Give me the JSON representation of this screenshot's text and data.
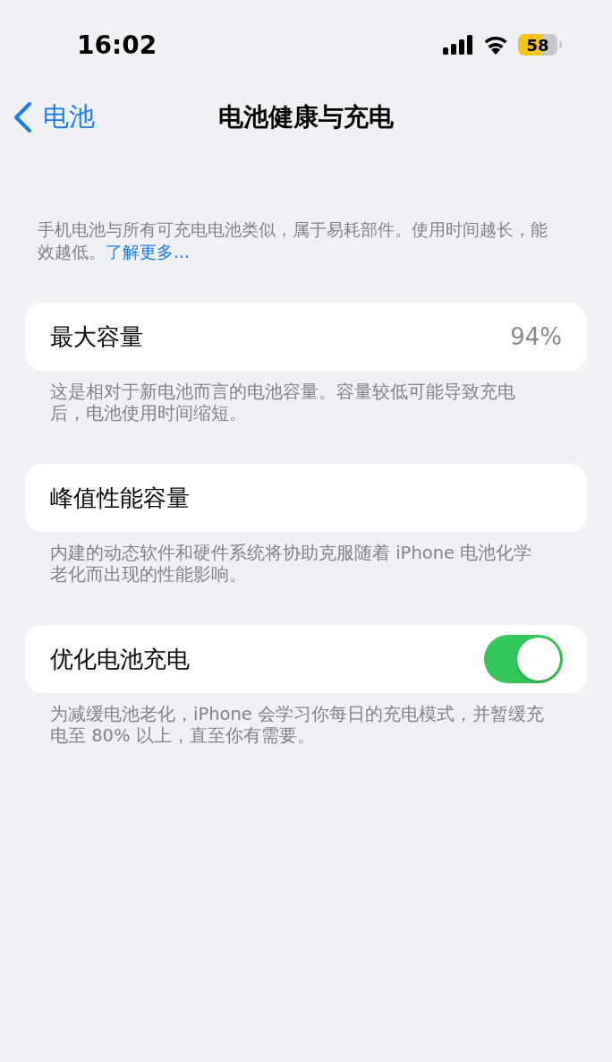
{
  "status_bar": {
    "time": "16:02",
    "battery": "58"
  },
  "nav": {
    "back": "电池",
    "title": "电池健康与充电"
  },
  "intro": {
    "text": "手机电池与所有可充电电池类似，属于易耗部件。使用时间越长，能效越低。",
    "link": "了解更多..."
  },
  "sections": [
    {
      "kind": "value",
      "label": "最大容量",
      "value": "94%",
      "footer": "这是相对于新电池而言的电池容量。容量较低可能导致充电后，电池使用时间缩短。"
    },
    {
      "kind": "plain",
      "label": "峰值性能容量",
      "footer": "内建的动态软件和硬件系统将协助克服随着 iPhone 电池化学老化而出现的性能影响。"
    },
    {
      "kind": "toggle",
      "label": "优化电池充电",
      "on": true,
      "footer": "为减缓电池老化，iPhone 会学习你每日的充电模式，并暂缓充电至 80% 以上，直至你有需要。"
    }
  ]
}
